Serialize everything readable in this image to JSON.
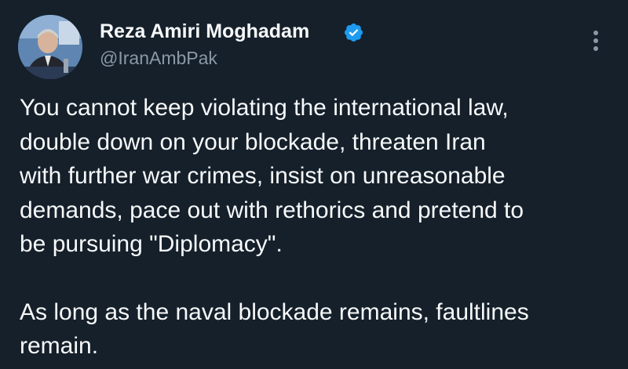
{
  "tweet": {
    "author": {
      "display_name": "Reza Amiri Moghadam",
      "handle": "@IranAmbPak",
      "verified_icon": "verified-badge-icon",
      "avatar_icon": "profile-photo"
    },
    "more_icon": "more-options-icon",
    "paragraph1_lines": [
      "You cannot keep violating the international law,",
      "double down on your blockade, threaten Iran",
      "with further war crimes, insist on unreasonable",
      "demands, pace out with rethorics and pretend to",
      "be pursuing \"Diplomacy\"."
    ],
    "paragraph2_lines": [
      "As long as the naval blockade remains, faultlines",
      "remain."
    ]
  },
  "colors": {
    "background": "#15202b",
    "text_primary": "#f7f9f9",
    "text_secondary": "#8b98a5",
    "verified_blue": "#1d9bf0"
  }
}
